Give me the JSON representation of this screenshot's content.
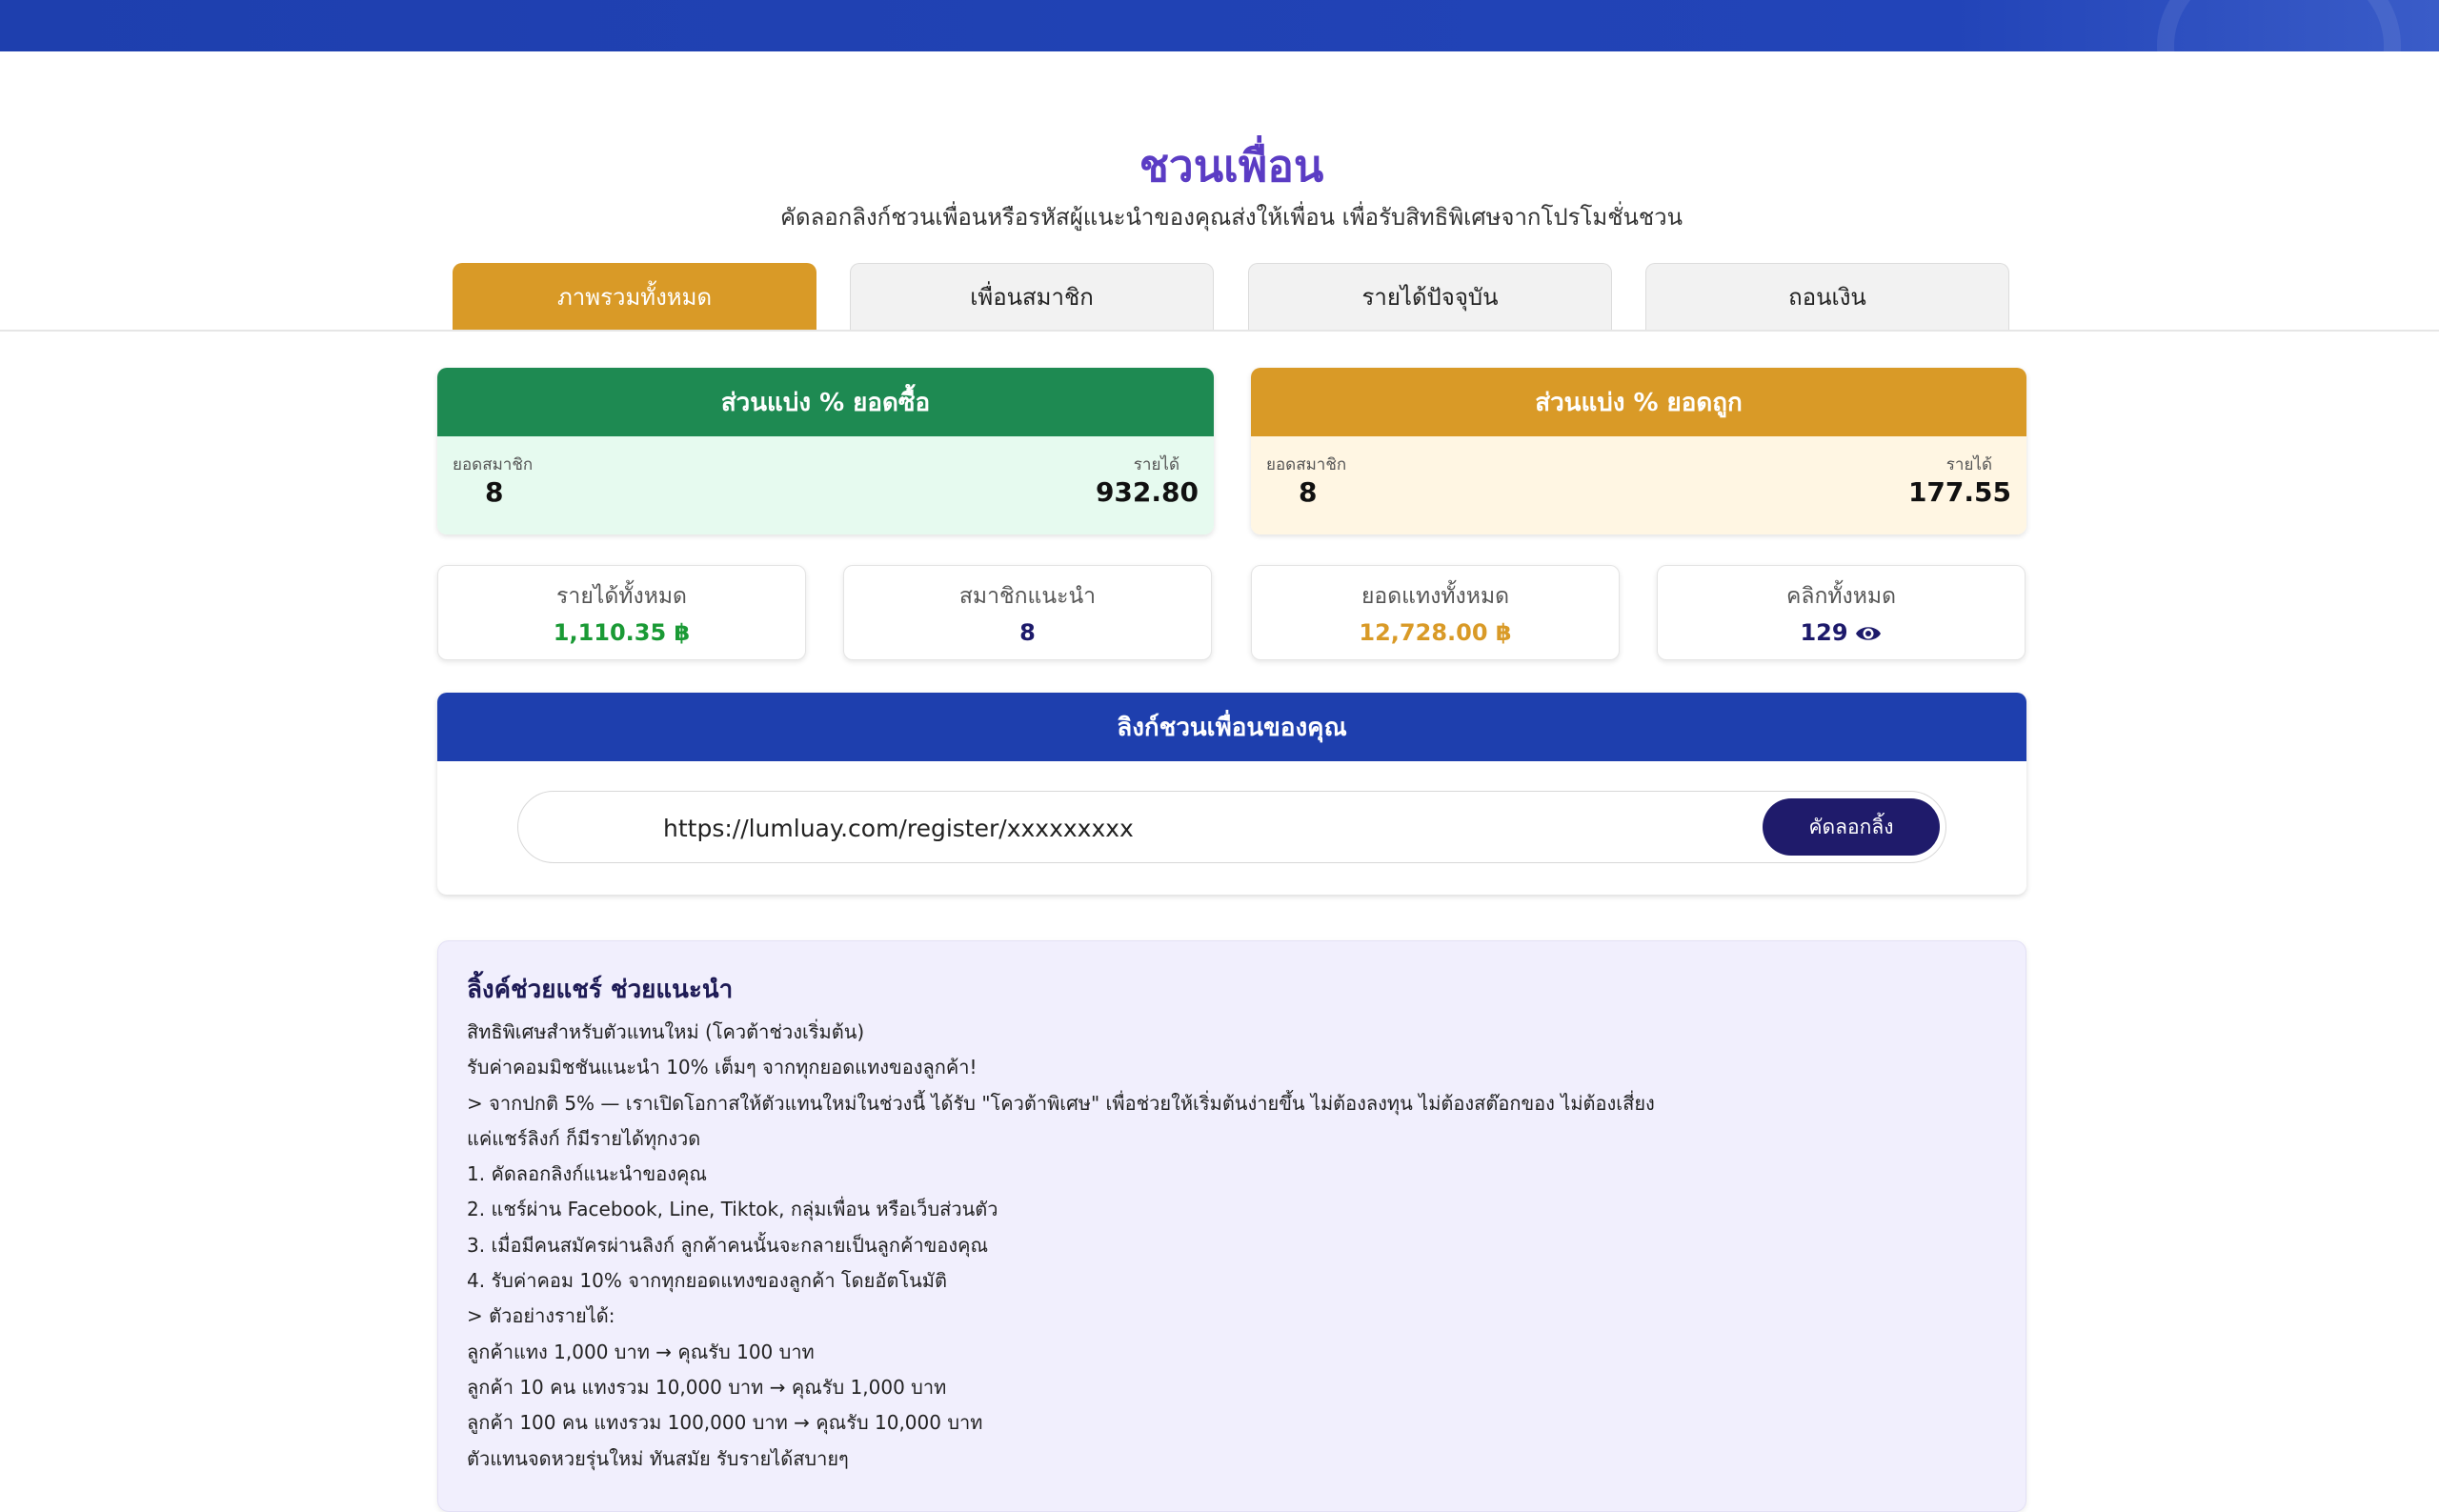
{
  "header": {
    "title": "ชวนเพื่อน",
    "subtitle": "คัดลอกลิงก์ชวนเพื่อนหรือรหัสผู้แนะนำของคุณส่งให้เพื่อน เพื่อรับสิทธิพิเศษจากโปรโมชั่นชวน"
  },
  "tabs": [
    {
      "label": "ภาพรวมทั้งหมด",
      "active": true
    },
    {
      "label": "เพื่อนสมาชิก",
      "active": false
    },
    {
      "label": "รายได้ปัจจุบัน",
      "active": false
    },
    {
      "label": "ถอนเงิน",
      "active": false
    }
  ],
  "share_cards": [
    {
      "title": "ส่วนแบ่ง % ยอดซื้อ",
      "member_label": "ยอดสมาชิก",
      "member_value": "8",
      "income_label": "รายได้",
      "income_value": "932.80",
      "color": "#1e8a52",
      "bg": "#e6faef"
    },
    {
      "title": "ส่วนแบ่ง % ยอดถูก",
      "member_label": "ยอดสมาชิก",
      "member_value": "8",
      "income_label": "รายได้",
      "income_value": "177.55",
      "color": "#d99a27",
      "bg": "#fff6e3"
    }
  ],
  "stats": [
    {
      "label": "รายได้ทั้งหมด",
      "value": "1,110.35 ฿",
      "color": "#1a9a35"
    },
    {
      "label": "สมาชิกแนะนำ",
      "value": "8",
      "color": "#1d1a6b"
    },
    {
      "label": "ยอดแทงทั้งหมด",
      "value": "12,728.00 ฿",
      "color": "#d99a27"
    },
    {
      "label": "คลิกทั้งหมด",
      "value": "129",
      "color": "#1d1a6b",
      "icon": "eye-icon"
    }
  ],
  "link_section": {
    "title": "ลิงก์ชวนเพื่อนของคุณ",
    "url": "https://lumluay.com/register/xxxxxxxxx",
    "copy_label": "คัดลอกลิ้ง"
  },
  "info": {
    "title": "ลิ้งค์ช่วยแชร์ ช่วยแนะนำ",
    "lines": [
      "สิทธิพิเศษสำหรับตัวแทนใหม่ (โควต้าช่วงเริ่มต้น)",
      "รับค่าคอมมิชชันแนะนำ 10% เต็มๆ จากทุกยอดแทงของลูกค้า!",
      "> จากปกติ 5% — เราเปิดโอกาสให้ตัวแทนใหม่ในช่วงนี้ ได้รับ \"โควต้าพิเศษ\" เพื่อช่วยให้เริ่มต้นง่ายขึ้น ไม่ต้องลงทุน ไม่ต้องสต๊อกของ ไม่ต้องเสี่ยง",
      "แค่แชร์ลิงก์ ก็มีรายได้ทุกงวด",
      "1. คัดลอกลิงก์แนะนำของคุณ",
      "2. แชร์ผ่าน Facebook, Line, Tiktok, กลุ่มเพื่อน หรือเว็บส่วนตัว",
      "3. เมื่อมีคนสมัครผ่านลิงก์ ลูกค้าคนนั้นจะกลายเป็นลูกค้าของคุณ",
      "4. รับค่าคอม 10% จากทุกยอดแทงของลูกค้า โดยอัตโนมัติ",
      "> ตัวอย่างรายได้:",
      "ลูกค้าแทง 1,000 บาท → คุณรับ 100 บาท",
      "ลูกค้า 10 คน แทงรวม 10,000 บาท → คุณรับ 1,000 บาท",
      "ลูกค้า 100 คน แทงรวม 100,000 บาท → คุณรับ 10,000 บาท",
      "ตัวแทนจดหวยรุ่นใหม่ ทันสมัย รับรายได้สบายๆ"
    ]
  }
}
